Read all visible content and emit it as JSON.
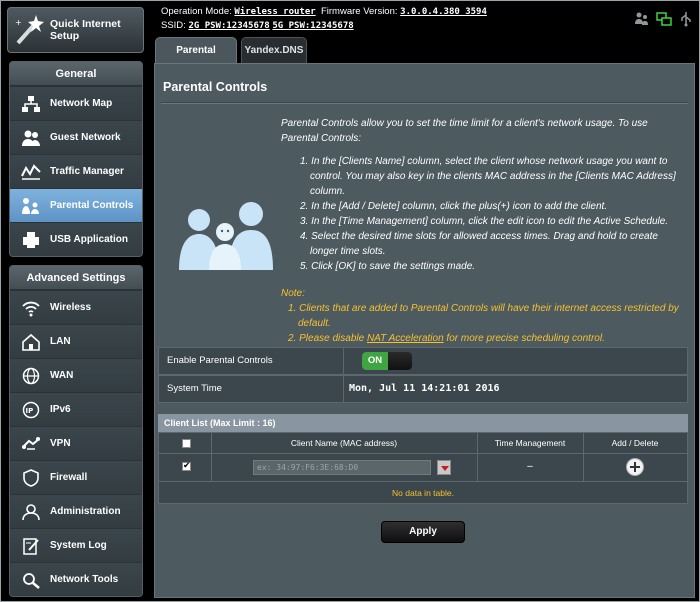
{
  "quick": {
    "label_line1": "Quick Internet",
    "label_line2": "Setup",
    "icon": "wand-icon"
  },
  "general": {
    "title": "General",
    "items": [
      {
        "label": "Network Map",
        "icon": "network-map-icon"
      },
      {
        "label": "Guest Network",
        "icon": "guest-network-icon"
      },
      {
        "label": "Traffic Manager",
        "icon": "traffic-manager-icon"
      },
      {
        "label": "Parental Controls",
        "icon": "parental-controls-icon",
        "active": true
      },
      {
        "label": "USB Application",
        "icon": "usb-application-icon"
      }
    ]
  },
  "advanced": {
    "title": "Advanced Settings",
    "items": [
      {
        "label": "Wireless",
        "icon": "wireless-icon"
      },
      {
        "label": "LAN",
        "icon": "lan-icon"
      },
      {
        "label": "WAN",
        "icon": "wan-icon"
      },
      {
        "label": "IPv6",
        "icon": "ipv6-icon"
      },
      {
        "label": "VPN",
        "icon": "vpn-icon"
      },
      {
        "label": "Firewall",
        "icon": "firewall-icon"
      },
      {
        "label": "Administration",
        "icon": "administration-icon"
      },
      {
        "label": "System Log",
        "icon": "system-log-icon"
      },
      {
        "label": "Network Tools",
        "icon": "network-tools-icon"
      }
    ]
  },
  "topbar": {
    "op_mode_label": "Operation Mode:",
    "op_mode_value": "Wireless router",
    "fw_label": "Firmware Version:",
    "fw_value": "3.0.0.4.380_3594",
    "ssid_label": "SSID:",
    "ssid_2g": "2G_PSW:12345678",
    "ssid_5g": "5G_PSW:12345678"
  },
  "tabs": [
    "Parental Controls",
    "Yandex.DNS"
  ],
  "page": {
    "title": "Parental Controls",
    "intro": "Parental Controls allow you to set the time limit for a client's network usage. To use Parental Controls:",
    "steps": [
      "1. In the [Clients Name] column, select the client whose network usage you want to control. You may also key in the clients MAC address in the [Clients MAC Address] column.",
      "2. In the [Add / Delete] column, click the plus(+) icon to add the client.",
      "3. In the [Time Management] column, click the edit icon to edit the Active Schedule.",
      "4. Select the desired time slots for allowed access times. Drag and hold to create longer time slots.",
      "5. Click [OK] to save the settings made."
    ],
    "note_label": "Note:",
    "note1": "1. Clients that are added to Parental Controls will have their internet access restricted by default.",
    "note2_pre": "2. Please disable ",
    "note2_link": "NAT Acceleration",
    "note2_post": " for more precise scheduling control."
  },
  "settings": {
    "enable_label": "Enable Parental Controls",
    "enable_state": "ON",
    "time_label": "System Time",
    "time_value": "Mon, Jul 11 14:21:01 2016"
  },
  "client_list": {
    "title": "Client List (Max Limit : 16)",
    "columns": [
      "",
      "Client Name (MAC address)",
      "Time Management",
      "Add / Delete"
    ],
    "mac_placeholder": "ex: 34:97:F6:3E:68:D0",
    "time_mgmt": "–",
    "empty": "No data in table."
  },
  "apply_label": "Apply",
  "colors": {
    "accent": "#5d93c5",
    "note": "#f7c12e",
    "toggle_on": "#3fa542",
    "panel": "#4d5a60"
  }
}
